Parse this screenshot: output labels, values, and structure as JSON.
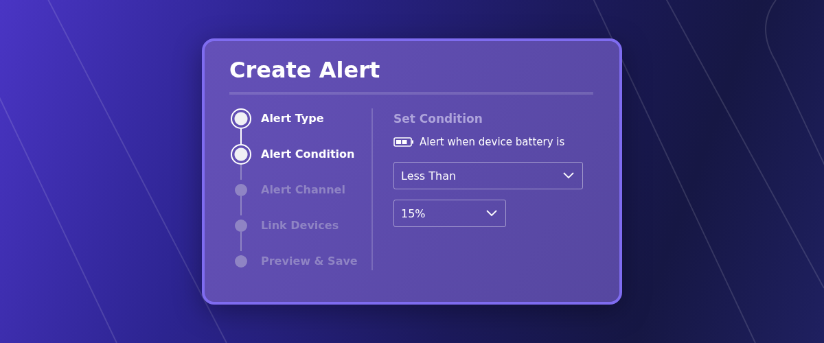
{
  "dialog": {
    "title": "Create Alert"
  },
  "steps": [
    {
      "label": "Alert Type",
      "done": true
    },
    {
      "label": "Alert Condition",
      "done": true
    },
    {
      "label": "Alert Channel",
      "done": false
    },
    {
      "label": "Link Devices",
      "done": false
    },
    {
      "label": "Preview & Save",
      "done": false
    }
  ],
  "condition": {
    "heading": "Set Condition",
    "description": "Alert when device battery is",
    "operator": {
      "value": "Less Than"
    },
    "threshold": {
      "value": "15%"
    }
  }
}
